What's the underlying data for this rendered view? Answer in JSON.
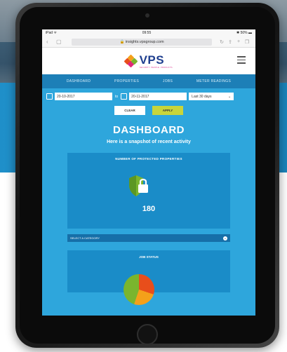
{
  "status_bar": {
    "carrier": "iPad ᯤ",
    "time": "09:55",
    "battery": "✱ 50% ▬"
  },
  "browser": {
    "url": "🔒 insights.vpsgroup.com"
  },
  "brand": {
    "name": "VPS",
    "tagline": "SECURITY. PEOPLE. PRODUCTS."
  },
  "nav": [
    "DASHBOARD",
    "PROPERTIES",
    "JOBS",
    "METER READINGS"
  ],
  "filters": {
    "from_date": "20-10-2017",
    "to_label": "to",
    "to_date": "20-11-2017",
    "range": "Last 30 days",
    "clear_label": "CLEAR",
    "apply_label": "APPLY"
  },
  "dashboard": {
    "title": "DASHBOARD",
    "subtitle": "Here is a snapshot of recent activity"
  },
  "protected_card": {
    "heading": "NUMBER OF PROTECTED PROPERTIES",
    "count": "180"
  },
  "category": {
    "label": "SELECT A CATEGORY"
  },
  "job_card": {
    "heading": "JOB STATUS"
  }
}
